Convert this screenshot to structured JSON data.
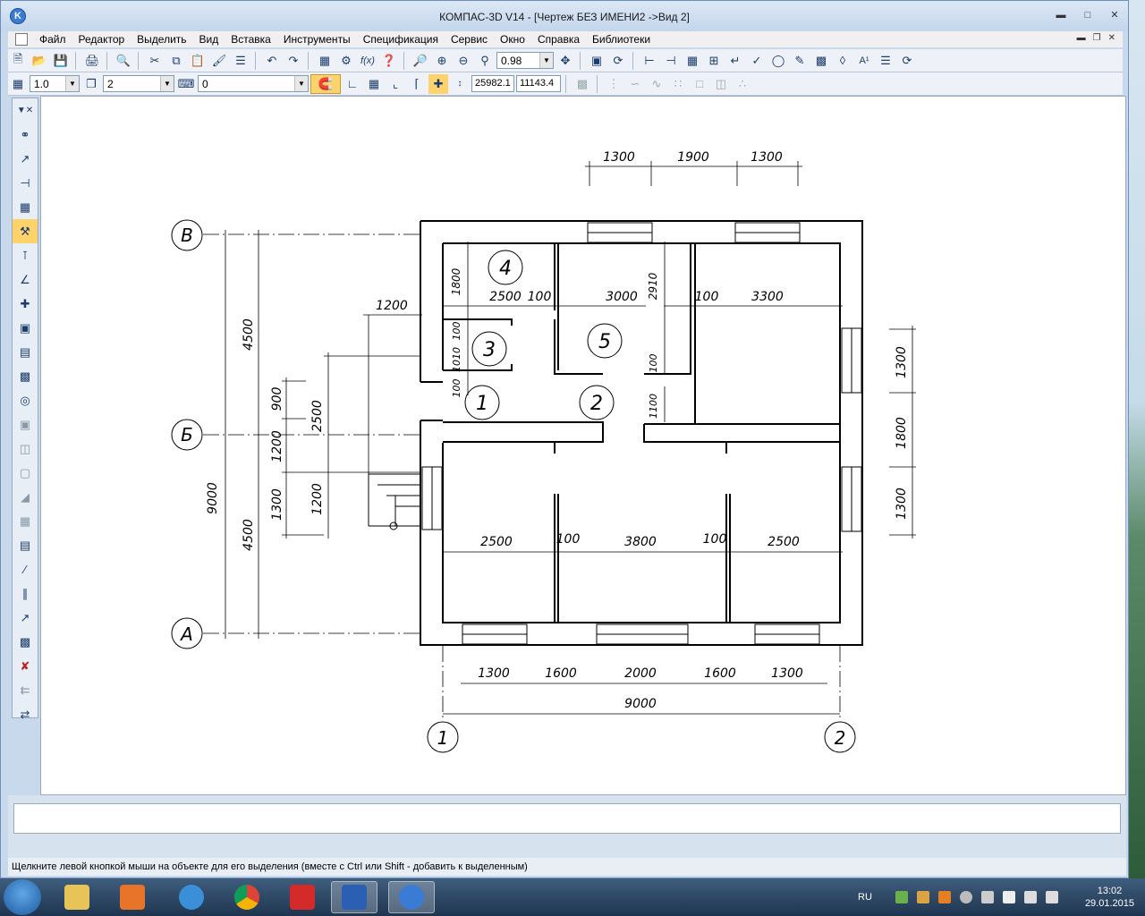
{
  "window": {
    "title": "КОМПАС-3D V14 - [Чертеж БЕЗ ИМЕНИ2 ->Вид 2]",
    "app_icon": "kompas-logo-icon",
    "controls": [
      "minimize-icon",
      "maximize-icon",
      "close-icon"
    ]
  },
  "menu": {
    "items": [
      "Файл",
      "Редактор",
      "Выделить",
      "Вид",
      "Вставка",
      "Инструменты",
      "Спецификация",
      "Сервис",
      "Окно",
      "Справка",
      "Библиотеки"
    ]
  },
  "toolbar1": {
    "zoom_value": "0.98"
  },
  "toolbar2": {
    "scale_value": "1.0",
    "layer_value": "2",
    "style_value": "0",
    "coord_x": "25982.1",
    "coord_y": "11143.4"
  },
  "drawing": {
    "top_dims": [
      "1300",
      "1900",
      "1300"
    ],
    "bottom_dims": [
      "1300",
      "1600",
      "2000",
      "1600",
      "1300"
    ],
    "bottom_total": "9000",
    "left_total": "9000",
    "left_halves": [
      "4500",
      "4500"
    ],
    "right_dims": [
      "1300",
      "1800",
      "1300"
    ],
    "stair_dims": [
      "1200",
      "900",
      "2500",
      "1200",
      "1300",
      "1200"
    ],
    "room_dims": {
      "d2500_upper": "2500",
      "d100_a": "100",
      "d3000": "3000",
      "d100_b": "100",
      "d3300": "3300",
      "d1800": "1800",
      "d2910": "2910",
      "d100_c": "100",
      "d1010": "1010",
      "d100_d": "100",
      "d100_e": "100",
      "d1100": "1100",
      "d2500_lower_l": "2500",
      "d100_f": "100",
      "d3800": "3800",
      "d100_g": "100",
      "d2500_lower_r": "2500"
    },
    "axes_rows": [
      "В",
      "Б",
      "А"
    ],
    "axes_cols": [
      "1",
      "2"
    ],
    "rooms": [
      "1",
      "2",
      "3",
      "4",
      "5"
    ]
  },
  "status": {
    "hint": "Щелкните левой кнопкой мыши на объекте для его выделения (вместе с Ctrl или Shift - добавить к выделенным)"
  },
  "taskbar": {
    "apps": [
      "explorer-icon",
      "media-player-icon",
      "internet-explorer-icon",
      "chrome-icon",
      "screen-recorder-icon",
      "word-icon",
      "kompas-icon"
    ],
    "language": "RU",
    "time": "13:02",
    "date": "29.01.2015"
  }
}
